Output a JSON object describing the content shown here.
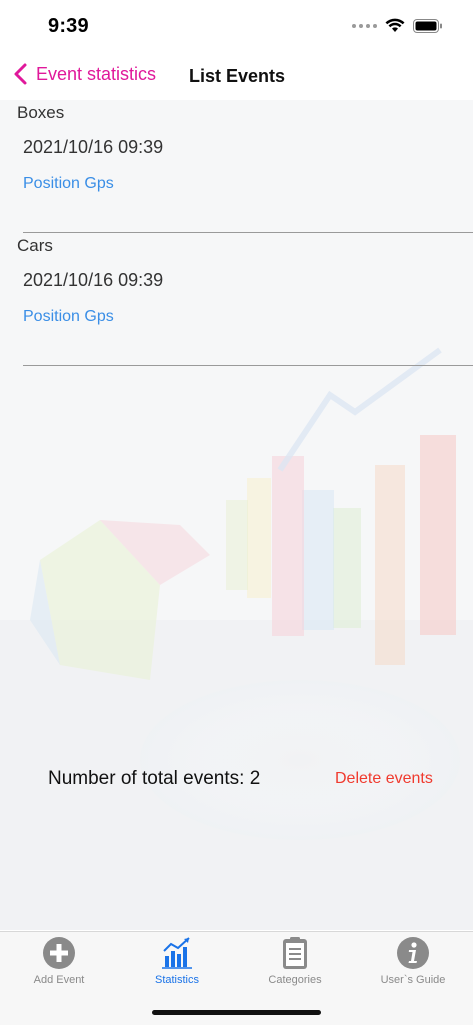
{
  "status_bar": {
    "time": "9:39"
  },
  "nav": {
    "back_label": "Event statistics",
    "title": "List Events"
  },
  "events": [
    {
      "name": "Boxes",
      "datetime": "2021/10/16 09:39",
      "link": "Position Gps"
    },
    {
      "name": "Cars",
      "datetime": "2021/10/16 09:39",
      "link": "Position Gps"
    }
  ],
  "summary": {
    "total_text": "Number of total events: 2",
    "delete_label": "Delete events"
  },
  "tabs": [
    {
      "label": "Add Event",
      "icon": "plus-circle-icon",
      "active": false
    },
    {
      "label": "Statistics",
      "icon": "bar-chart-icon",
      "active": true
    },
    {
      "label": "Categories",
      "icon": "clipboard-icon",
      "active": false
    },
    {
      "label": "User`s Guide",
      "icon": "info-icon",
      "active": false
    }
  ],
  "colors": {
    "accent": "#e0189b",
    "link": "#3a8ee6",
    "destructive": "#f03a2e",
    "tab_active": "#1a73e8",
    "tab_inactive": "#8a8a8a"
  }
}
